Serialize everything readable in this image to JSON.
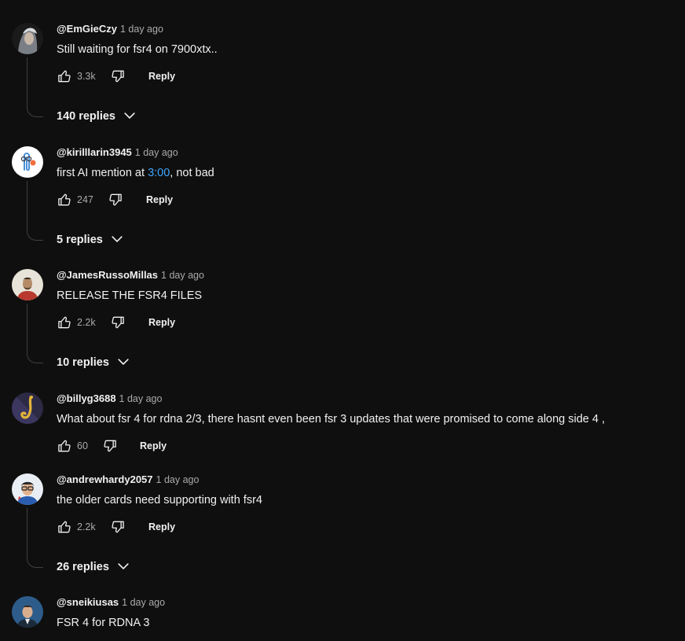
{
  "comments": [
    {
      "author": "@EmGieCzy",
      "time": "1 day ago",
      "text": "Still waiting for fsr4 on 7900xtx..",
      "likes": "3.3k",
      "reply_label": "Reply",
      "replies": "140 replies"
    },
    {
      "author": "@kirilllarin3945",
      "time": "1 day ago",
      "text_before": "first AI mention at ",
      "timestamp": "3:00",
      "text_after": ", not bad",
      "likes": "247",
      "reply_label": "Reply",
      "replies": "5 replies"
    },
    {
      "author": "@JamesRussoMillas",
      "time": "1 day ago",
      "text": "RELEASE THE FSR4 FILES",
      "likes": "2.2k",
      "reply_label": "Reply",
      "replies": "10 replies"
    },
    {
      "author": "@billyg3688",
      "time": "1 day ago",
      "text": "What about fsr 4 for rdna 2/3, there hasnt even been fsr 3 updates that were promised to come along side 4 ,",
      "likes": "60",
      "reply_label": "Reply"
    },
    {
      "author": "@andrewhardy2057",
      "time": "1 day ago",
      "text": "the older cards need supporting with fsr4",
      "likes": "2.2k",
      "reply_label": "Reply",
      "replies": "26 replies"
    },
    {
      "author": "@sneikiusas",
      "time": "1 day ago",
      "text": "FSR 4 for RDNA 3"
    }
  ],
  "icons": {
    "like": "thumbs-up-icon",
    "dislike": "thumbs-down-icon",
    "expand": "chevron-down-icon"
  },
  "colors": {
    "background": "#0f0f0f",
    "link": "#3ea6ff",
    "secondary_text": "#aaaaaa"
  }
}
